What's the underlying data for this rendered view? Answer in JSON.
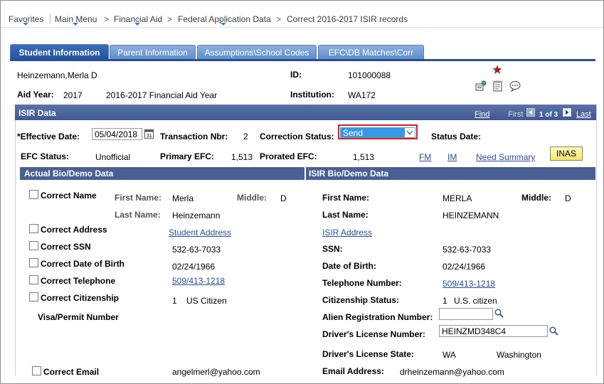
{
  "breadcrumb": {
    "favorites": "Favorites",
    "main_menu": "Main Menu",
    "financial_aid": "Financial Aid",
    "federal_app": "Federal Application Data",
    "current": "Correct 2016-2017 ISIR records",
    "sep": ">"
  },
  "tabs": [
    {
      "label": "Student Information"
    },
    {
      "label": "Parent Information"
    },
    {
      "label": "Assumptions\\School Codes"
    },
    {
      "label": "EFC\\DB Matches\\Corr"
    }
  ],
  "header": {
    "student_name": "Heinzemann,Merla D",
    "id_label": "ID:",
    "id_value": "101000088",
    "aid_year_label": "Aid Year:",
    "aid_year_value": "2017",
    "aid_year_desc": "2016-2017 Financial Aid Year",
    "institution_label": "Institution:",
    "institution_value": "WA172"
  },
  "isir": {
    "title": "ISIR Data",
    "find": "Find",
    "first": "First",
    "pager": "1 of 3",
    "last": "Last",
    "effective_date_label": "*Effective Date:",
    "effective_date_value": "05/04/2018",
    "transaction_label": "Transaction Nbr:",
    "transaction_value": "2",
    "correction_status_label": "Correction Status:",
    "correction_status_value": "Send",
    "status_date_label": "Status Date:",
    "efc_status_label": "EFC Status:",
    "efc_status_value": "Unofficial",
    "primary_efc_label": "Primary EFC:",
    "primary_efc_value": "1,513",
    "prorated_efc_label": "Prorated EFC:",
    "prorated_efc_value": "1,513",
    "fm": "FM",
    "im": "IM",
    "need_summary": "Need Summary",
    "inas": "INAS"
  },
  "actual": {
    "title": "Actual Bio/Demo Data",
    "correct_name": "Correct Name",
    "first_name_label": "First Name:",
    "first_name": "Merla",
    "middle_label": "Middle:",
    "middle": "D",
    "last_name_label": "Last Name:",
    "last_name": "Heinzemann",
    "correct_address": "Correct Address",
    "student_address": "Student Address",
    "correct_ssn": "Correct SSN",
    "ssn": "532-63-7033",
    "correct_dob": "Correct Date of Birth",
    "dob": "02/24/1966",
    "correct_phone": "Correct Telephone",
    "phone": "509/413-1218",
    "correct_citizenship": "Correct Citizenship",
    "citizenship_code": "1",
    "citizenship": "US Citizen",
    "visa_label": "Visa/Permit Number",
    "correct_email": "Correct Email",
    "email": "angelmerl@yahoo.com"
  },
  "isir_bio": {
    "title": "ISIR Bio/Demo Data",
    "first_name_label": "First Name:",
    "first_name": "MERLA",
    "middle_label": "Middle:",
    "middle": "D",
    "last_name_label": "Last Name:",
    "last_name": "HEINZEMANN",
    "isir_address": "ISIR Address",
    "ssn_label": "SSN:",
    "ssn": "532-63-7033",
    "dob_label": "Date of Birth:",
    "dob": "02/24/1966",
    "phone_label": "Telephone Number:",
    "phone": "509/413-1218",
    "citizenship_label": "Citizenship Status:",
    "citizenship_code": "1",
    "citizenship": "U.S. citizen",
    "alien_label": "Alien Registration Number:",
    "alien_value": "",
    "dl_number_label": "Driver's License Number:",
    "dl_number": "HEINZMD348C4",
    "dl_state_label": "Driver's License State:",
    "dl_state_code": "WA",
    "dl_state": "Washington",
    "email_label": "Email Address:",
    "email": "drheinzemann@yahoo.com"
  },
  "colors": {
    "tab_active": "#234f99",
    "section_header": "#4a5f94",
    "link": "#2a4c9b",
    "highlight_box": "#d21f1f",
    "select_fill": "#3399e6"
  }
}
